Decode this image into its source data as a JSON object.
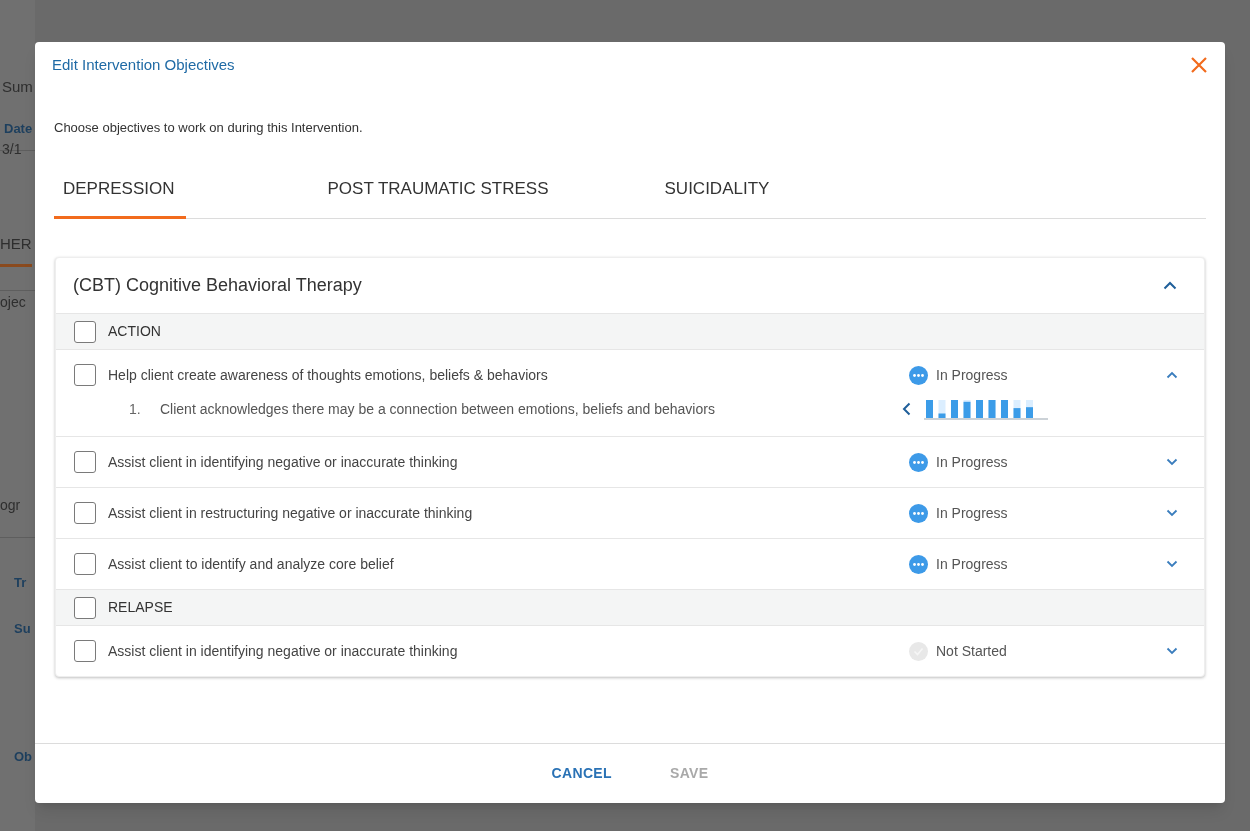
{
  "background_page": {
    "fragments": [
      {
        "text": "Sum",
        "kind": "heading"
      },
      {
        "text": "Date",
        "kind": "link"
      },
      {
        "text": "3/1",
        "kind": "label"
      },
      {
        "text": "HER",
        "kind": "tab"
      },
      {
        "text": "ojec",
        "kind": "label"
      },
      {
        "text": "ogr",
        "kind": "label"
      },
      {
        "text": "Tr",
        "kind": "link"
      },
      {
        "text": "Su",
        "kind": "link"
      },
      {
        "text": "Ob",
        "kind": "link"
      }
    ]
  },
  "dialog": {
    "title": "Edit Intervention Objectives",
    "description": "Choose objectives to work on during this Intervention.",
    "tabs": [
      {
        "label": "DEPRESSION",
        "selected": true
      },
      {
        "label": "POST TRAUMATIC STRESS",
        "selected": false
      },
      {
        "label": "SUICIDALITY",
        "selected": false
      }
    ],
    "program": {
      "title": "(CBT) Cognitive Behavioral Therapy",
      "expanded": true,
      "groups": [
        {
          "label": "ACTION",
          "checked": false,
          "items": [
            {
              "text": "Help client create awareness of thoughts emotions, beliefs & behaviors",
              "checked": false,
              "status": "In Progress",
              "kind": "in_progress",
              "expanded": true,
              "steps": [
                {
                  "number": "1.",
                  "text": "Client acknowledges there may be a connection between emotions, beliefs and behaviors"
                }
              ]
            },
            {
              "text": "Assist client in identifying negative or inaccurate thinking",
              "checked": false,
              "status": "In Progress",
              "kind": "in_progress",
              "expanded": false
            },
            {
              "text": "Assist client in restructuring negative or inaccurate thinking",
              "checked": false,
              "status": "In Progress",
              "kind": "in_progress",
              "expanded": false
            },
            {
              "text": "Assist client to identify and analyze core belief",
              "checked": false,
              "status": "In Progress",
              "kind": "in_progress",
              "expanded": false
            }
          ]
        },
        {
          "label": "RELAPSE",
          "checked": false,
          "items": [
            {
              "text": "Assist client in identifying negative or inaccurate thinking",
              "checked": false,
              "status": "Not Started",
              "kind": "not_started",
              "expanded": false
            }
          ]
        }
      ]
    }
  },
  "buttons": [
    {
      "label": "CANCEL",
      "disabled": false
    },
    {
      "label": "SAVE",
      "disabled": true
    }
  ]
}
